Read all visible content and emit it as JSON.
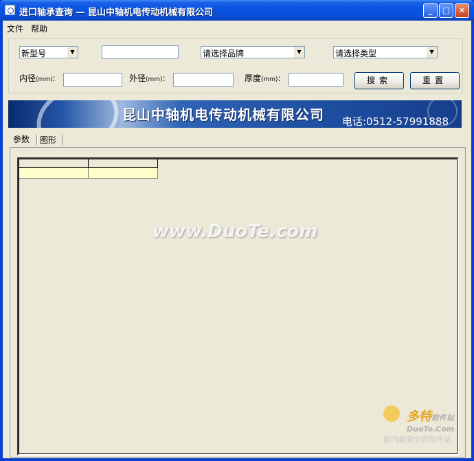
{
  "window": {
    "title": "进口轴承查询 — 昆山中轴机电传动机械有限公司",
    "controls": {
      "minimize": "_",
      "maximize": "□",
      "close": "✕"
    }
  },
  "menu": {
    "file": "文件",
    "help": "帮助"
  },
  "search": {
    "model_combo": "新型号",
    "model_input": "",
    "brand_combo": "请选择品牌",
    "type_combo": "请选择类型",
    "inner_label": "内径",
    "outer_label": "外径",
    "thickness_label": "厚度",
    "unit": "(mm)",
    "colon": ":",
    "inner_value": "",
    "outer_value": "",
    "thickness_value": "",
    "search_button": "搜索",
    "reset_button": "重置"
  },
  "banner": {
    "company": "昆山中轴机电传动机械有限公司",
    "phone": "电话:0512-57991888"
  },
  "tabs": [
    {
      "label": "参数",
      "active": true
    },
    {
      "label": "图形",
      "active": false
    }
  ],
  "watermarks": {
    "center": "www.DuoTe.com",
    "brand": "多特",
    "brand_suffix": "软件站",
    "site": "DuoTe.Com",
    "slogan": "国内最安全的软件站"
  }
}
